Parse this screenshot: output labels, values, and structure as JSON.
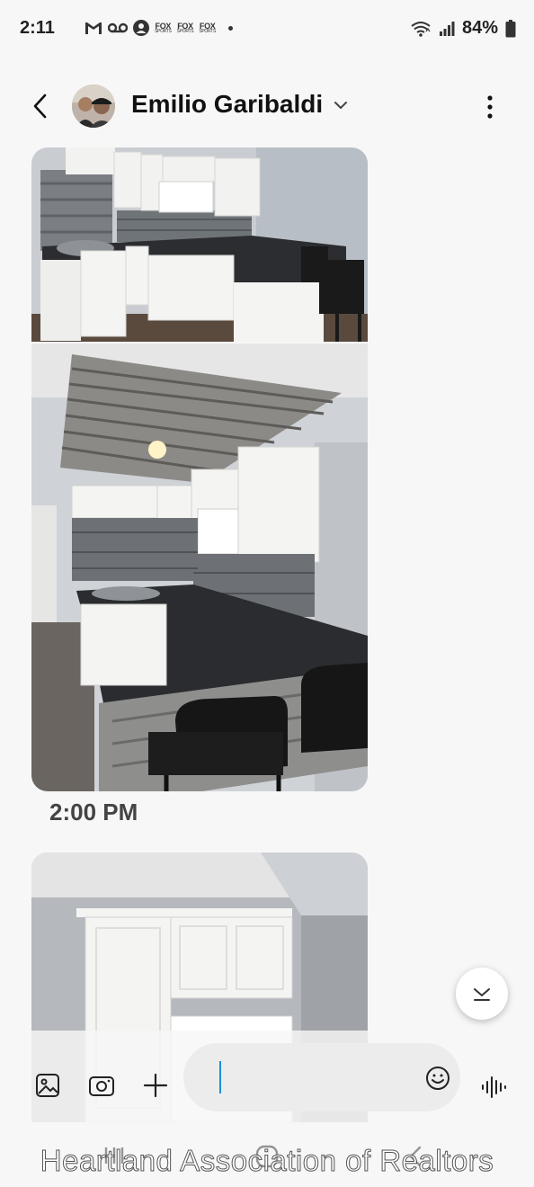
{
  "status_bar": {
    "time": "2:11",
    "battery": "84%",
    "left_icons": [
      "gmail-icon",
      "voicemail-icon",
      "account-icon",
      "fox-sports-icon",
      "fox-sports-icon",
      "fox-sports-icon",
      "dot-icon"
    ],
    "fox_logo_top": "FOX",
    "fox_logo_bottom": "SPORTS",
    "right_icons": [
      "wifi-icon",
      "signal-icon",
      "battery-icon"
    ]
  },
  "header": {
    "contact_name": "Emilio Garibaldi"
  },
  "messages": {
    "timestamp": "2:00 PM"
  },
  "watermark": "Heartland Association of Realtors",
  "colors": {
    "background": "#f7f7f7",
    "cursor": "#1a8fd6",
    "countertop": "#2b2d30",
    "cabinet": "#f4f4f2"
  }
}
